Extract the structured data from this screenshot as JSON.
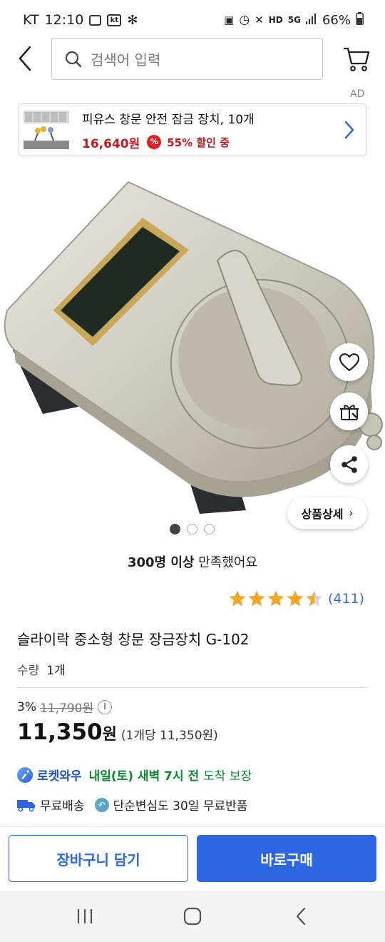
{
  "status_bar": {
    "carrier": "KT",
    "time": "12:10",
    "network": "5G",
    "battery": "66%"
  },
  "search": {
    "placeholder": "검색어 입력"
  },
  "ad": {
    "label": "AD",
    "title": "피유스 창문 안전 잠금 장치, 10개",
    "price": "16,640원",
    "badge": "%",
    "discount": "55% 할인 중"
  },
  "product_detail_label": "상품상세",
  "satisfaction": {
    "bold": "300명 이상",
    "rest": " 만족했어요"
  },
  "rating": {
    "stars": 4.5,
    "review_count": "(411)",
    "star_color": "#f5a623"
  },
  "product": {
    "title": "슬라이락 중소형 창문 장금장치 G-102",
    "qty_label": "수량",
    "qty_value": "1개",
    "discount_rate": "3%",
    "original_price": "11,790원",
    "price": "11,350",
    "currency": "원",
    "unit_price": "(1개당 11,350원)"
  },
  "delivery": {
    "rocket_label": "로켓와우",
    "date": "내일(토) 새벽 7시 전",
    "suffix": "도착 보장",
    "free_shipping": "무료배송",
    "free_return": "단순변심도 30일 무료반품"
  },
  "buttons": {
    "cart": "장바구니 담기",
    "buy": "바로구매"
  },
  "colors": {
    "accent": "#2d66e3",
    "sale_red": "#c8161e",
    "delivery_green": "#0b8a2e"
  }
}
